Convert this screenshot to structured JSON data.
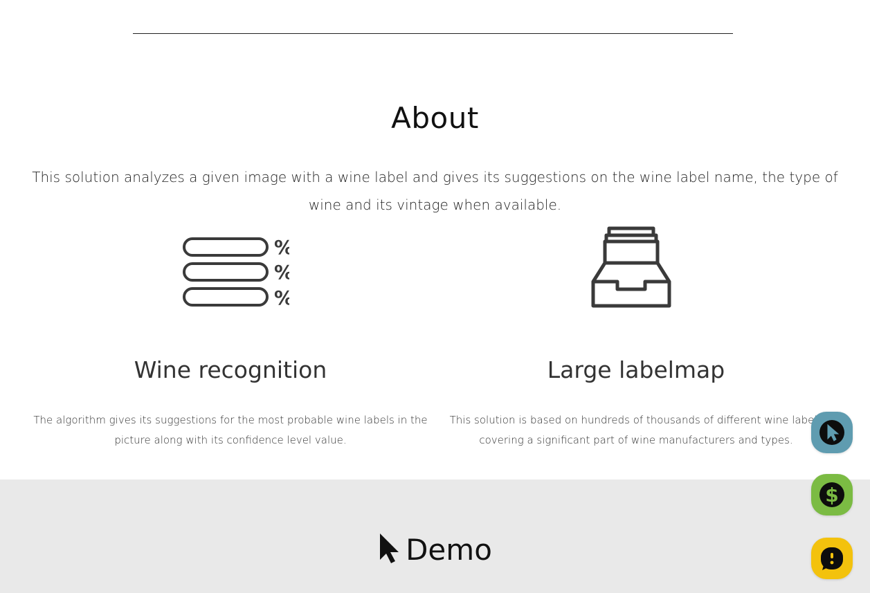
{
  "about": {
    "title": "About",
    "description": "This solution analyzes a given image with a wine label and gives its suggestions on the wine label name, the type of wine and its vintage when available."
  },
  "features": [
    {
      "icon": "percent-list-icon",
      "title": "Wine recognition",
      "text": "The algorithm gives its suggestions for the most probable wine labels in the picture along with its confidence level value."
    },
    {
      "icon": "archive-tray-icon",
      "title": "Large labelmap",
      "text": "This solution is based on hundreds of thousands of different wine labels covering a significant part of wine manufacturers and types."
    }
  ],
  "demo": {
    "title": "Demo",
    "icon": "cursor-icon"
  },
  "floating_buttons": [
    {
      "icon": "cursor-icon",
      "color": "#5f9cb0"
    },
    {
      "icon": "dollar-icon",
      "color": "#7bbb43"
    },
    {
      "icon": "chat-icon",
      "color": "#f3c20d"
    }
  ],
  "colors": {
    "demo_band": "#e9e9e9",
    "icon_gray": "#3a3a3a"
  }
}
